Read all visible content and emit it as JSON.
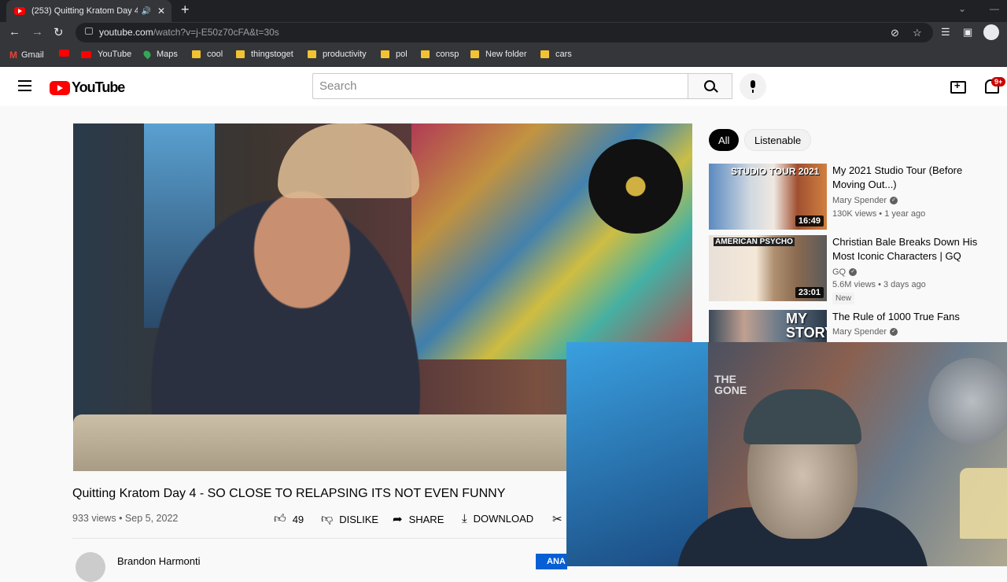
{
  "browser": {
    "tab_title": "(253) Quitting Kratom Day 4 ",
    "url_host": "youtube.com",
    "url_path": "/watch?v=j-E50z70cFA&t=30s",
    "bookmarks": [
      "Gmail",
      "YouTube",
      "Maps",
      "cool",
      "thingstoget",
      "productivity",
      "pol",
      "consp",
      "New folder",
      "cars"
    ]
  },
  "youtube": {
    "logo_text": "YouTube",
    "search_placeholder": "Search",
    "notification_count": "9+",
    "video": {
      "title": "Quitting Kratom Day 4 - SO CLOSE TO RELAPSING ITS NOT EVEN FUNNY",
      "views": "933 views",
      "date": "Sep 5, 2022",
      "likes": "49",
      "dislike_label": "DISLIKE",
      "share_label": "SHARE",
      "download_label": "DOWNLOAD",
      "channel": "Brandon Harmonti",
      "subscribe_label": "ANA"
    },
    "chips": [
      "All",
      "Listenable"
    ],
    "related": [
      {
        "title": "My 2021 Studio Tour (Before Moving Out...)",
        "channel": "Mary Spender",
        "stats": "130K views • 1 year ago",
        "duration": "16:49",
        "thumb_text": "STUDIO TOUR 2021"
      },
      {
        "title": "Christian Bale Breaks Down His Most Iconic Characters | GQ",
        "channel": "GQ",
        "stats": "5.6M views • 3 days ago",
        "duration": "23:01",
        "badge": "New",
        "thumb_text": "AMERICAN PSYCHO"
      },
      {
        "title": "The Rule of 1000 True Fans",
        "channel": "Mary Spender",
        "thumb_text": "MY STORY"
      }
    ]
  },
  "webcam": {
    "poster_text": "THE GONE"
  }
}
